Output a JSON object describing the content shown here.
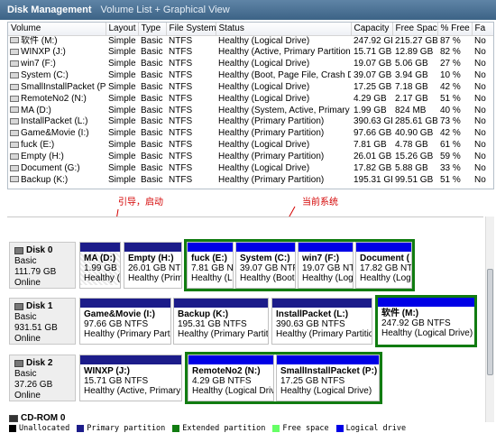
{
  "window": {
    "title": "Disk Management",
    "view_label": "Volume List + Graphical View"
  },
  "columns": [
    "Volume",
    "Layout",
    "Type",
    "File System",
    "Status",
    "Capacity",
    "Free Space",
    "% Free",
    "Fa"
  ],
  "volumes": [
    [
      "软件 (M:)",
      "Simple",
      "Basic",
      "NTFS",
      "Healthy (Logical Drive)",
      "247.92 GB",
      "215.27 GB",
      "87 %",
      "No"
    ],
    [
      "WINXP (J:)",
      "Simple",
      "Basic",
      "NTFS",
      "Healthy (Active, Primary Partition)",
      "15.71 GB",
      "12.89 GB",
      "82 %",
      "No"
    ],
    [
      "win7 (F:)",
      "Simple",
      "Basic",
      "NTFS",
      "Healthy (Logical Drive)",
      "19.07 GB",
      "5.06 GB",
      "27 %",
      "No"
    ],
    [
      "System (C:)",
      "Simple",
      "Basic",
      "NTFS",
      "Healthy (Boot, Page File, Crash D...",
      "39.07 GB",
      "3.94 GB",
      "10 %",
      "No"
    ],
    [
      "SmallInstallPacket (P:)",
      "Simple",
      "Basic",
      "NTFS",
      "Healthy (Logical Drive)",
      "17.25 GB",
      "7.18 GB",
      "42 %",
      "No"
    ],
    [
      "RemoteNo2 (N:)",
      "Simple",
      "Basic",
      "NTFS",
      "Healthy (Logical Drive)",
      "4.29 GB",
      "2.17 GB",
      "51 %",
      "No"
    ],
    [
      "MA (D:)",
      "Simple",
      "Basic",
      "NTFS",
      "Healthy (System, Active, Primary ...",
      "1.99 GB",
      "824 MB",
      "40 %",
      "No"
    ],
    [
      "InstallPacket (L:)",
      "Simple",
      "Basic",
      "NTFS",
      "Healthy (Primary Partition)",
      "390.63 GB",
      "285.61 GB",
      "73 %",
      "No"
    ],
    [
      "Game&Movie (I:)",
      "Simple",
      "Basic",
      "NTFS",
      "Healthy (Primary Partition)",
      "97.66 GB",
      "40.90 GB",
      "42 %",
      "No"
    ],
    [
      "fuck (E:)",
      "Simple",
      "Basic",
      "NTFS",
      "Healthy (Logical Drive)",
      "7.81 GB",
      "4.78 GB",
      "61 %",
      "No"
    ],
    [
      "Empty (H:)",
      "Simple",
      "Basic",
      "NTFS",
      "Healthy (Primary Partition)",
      "26.01 GB",
      "15.26 GB",
      "59 %",
      "No"
    ],
    [
      "Document (G:)",
      "Simple",
      "Basic",
      "NTFS",
      "Healthy (Logical Drive)",
      "17.82 GB",
      "5.88 GB",
      "33 %",
      "No"
    ],
    [
      "Backup (K:)",
      "Simple",
      "Basic",
      "NTFS",
      "Healthy (Primary Partition)",
      "195.31 GB",
      "99.51 GB",
      "51 %",
      "No"
    ]
  ],
  "annotations": {
    "boot": "引导，启动",
    "current": "当前系统"
  },
  "disks": [
    {
      "name": "Disk 0",
      "type": "Basic",
      "size": "111.79 GB",
      "state": "Online",
      "parts": [
        {
          "l1": "MA  (D:)",
          "l2": "1.99 GB N",
          "l3": "Healthy (",
          "bar": "pri"
        },
        {
          "l1": "Empty  (H:)",
          "l2": "26.01 GB NTFS",
          "l3": "Healthy (Prim",
          "bar": "pri"
        },
        {
          "l1": "fuck  (E:)",
          "l2": "7.81 GB NT",
          "l3": "Healthy (Lo",
          "bar": "log"
        },
        {
          "l1": "System  (C:)",
          "l2": "39.07 GB NTFS",
          "l3": "Healthy (Boot,",
          "bar": "log"
        },
        {
          "l1": "win7  (F:)",
          "l2": "19.07 GB NT",
          "l3": "Healthy (Log",
          "bar": "log"
        },
        {
          "l1": "Document  (",
          "l2": "17.82 GB NT",
          "l3": "Healthy (Log",
          "bar": "log"
        }
      ]
    },
    {
      "name": "Disk 1",
      "type": "Basic",
      "size": "931.51 GB",
      "state": "Online",
      "parts": [
        {
          "l1": "Game&Movie  (I:)",
          "l2": "97.66 GB NTFS",
          "l3": "Healthy (Primary Partiti",
          "bar": "pri"
        },
        {
          "l1": "Backup  (K:)",
          "l2": "195.31 GB NTFS",
          "l3": "Healthy (Primary Partition",
          "bar": "pri"
        },
        {
          "l1": "InstallPacket  (L:)",
          "l2": "390.63 GB NTFS",
          "l3": "Healthy (Primary Partition)",
          "bar": "pri"
        },
        {
          "l1": "软件  (M:)",
          "l2": "247.92 GB NTFS",
          "l3": "Healthy (Logical Drive)",
          "bar": "log"
        }
      ]
    },
    {
      "name": "Disk 2",
      "type": "Basic",
      "size": "37.26 GB",
      "state": "Online",
      "parts": [
        {
          "l1": "WINXP  (J:)",
          "l2": "15.71 GB NTFS",
          "l3": "Healthy (Active, Primary P",
          "bar": "pri"
        },
        {
          "l1": "RemoteNo2  (N:)",
          "l2": "4.29 GB NTFS",
          "l3": "Healthy (Logical Drive",
          "bar": "log"
        },
        {
          "l1": "SmallInstallPacket  (P:)",
          "l2": "17.25 GB NTFS",
          "l3": "Healthy (Logical Drive)",
          "bar": "log"
        }
      ]
    }
  ],
  "cdrom": "CD-ROM 0",
  "legend": [
    {
      "label": "Unallocated",
      "color": "#000000"
    },
    {
      "label": "Primary partition",
      "color": "#1c1c8a"
    },
    {
      "label": "Extended partition",
      "color": "#117c11"
    },
    {
      "label": "Free space",
      "color": "#66ff66"
    },
    {
      "label": "Logical drive",
      "color": "#0000e6"
    }
  ]
}
